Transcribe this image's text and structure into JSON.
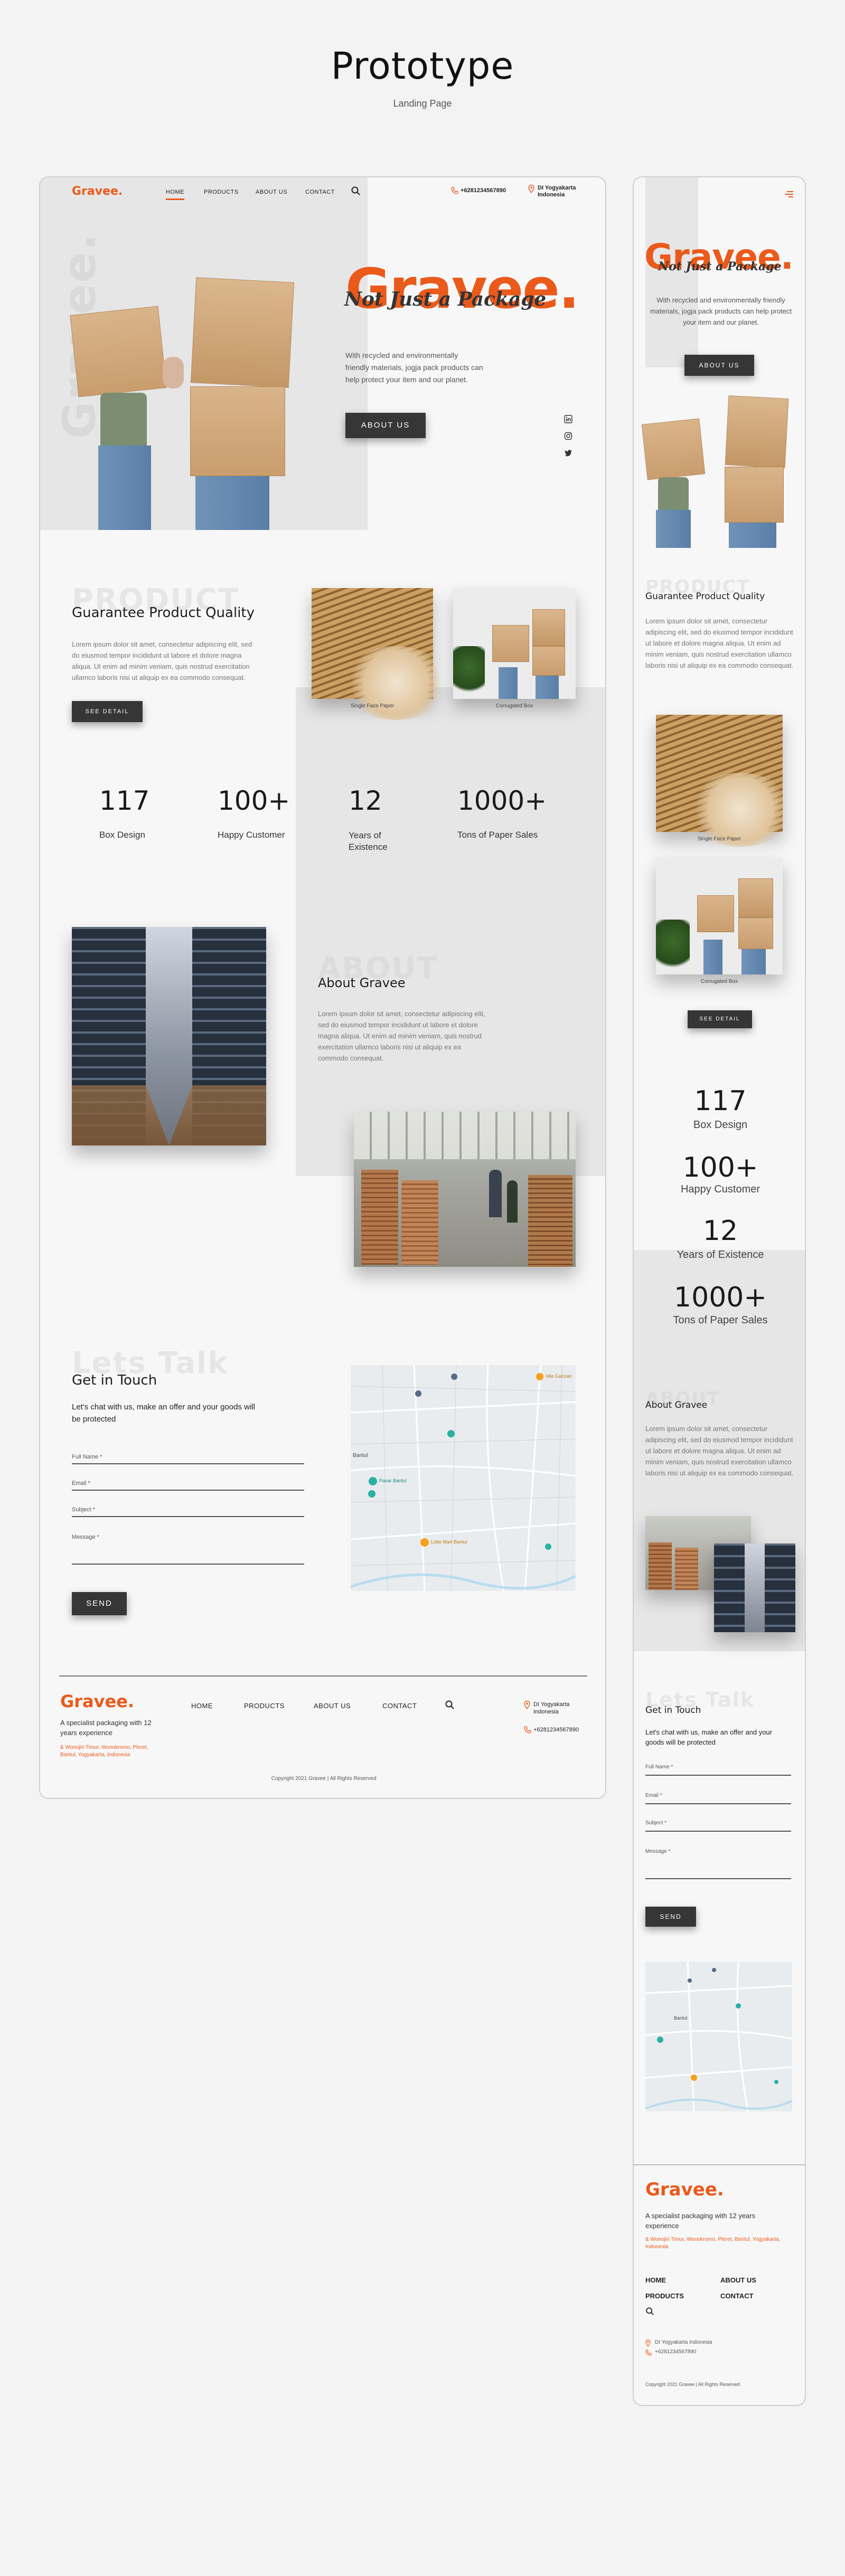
{
  "page": {
    "title": "Prototype",
    "subtitle": "Landing Page"
  },
  "brand": {
    "logo": "Gravee.",
    "tagline": "Not Just a Package",
    "accent": "#ea5a1b"
  },
  "nav": {
    "items": [
      "HOME",
      "PRODUCTS",
      "ABOUT US",
      "CONTACT"
    ],
    "phone": "+6281234567890",
    "address_line1": "DI Yogyakarta",
    "address_line2": "Indonesia"
  },
  "hero": {
    "ghost": "Gravee.",
    "title": "Gravee.",
    "script": "Not Just a Package",
    "text": "With recycled and environmentally friendly materials, jogja pack products can help protect your item and our planet.",
    "cta": "ABOUT US",
    "social_icons": [
      "linkedin-icon",
      "instagram-icon",
      "twitter-icon"
    ]
  },
  "product": {
    "ghost": "PRODUCT",
    "title": "Guarantee Product Quality",
    "text": "Lorem ipsum dolor sit amet, consectetur adipiscing elit, sed do eiusmod tempor incididunt ut labore et dolore magna aliqua. Ut enim ad minim veniam, quis nostrud exercitation ullamco laboris nisi ut aliquip ex ea commodo consequat.",
    "cta": "SEE DETAIL",
    "items": [
      {
        "caption": "Single Face Paper"
      },
      {
        "caption": "Corrugated Box"
      }
    ]
  },
  "stats": [
    {
      "value": "117",
      "label": "Box Design"
    },
    {
      "value": "100+",
      "label": "Happy Customer"
    },
    {
      "value": "12",
      "label": "Years of Existence"
    },
    {
      "value": "1000+",
      "label": "Tons of Paper Sales"
    }
  ],
  "about": {
    "ghost": "ABOUT",
    "title": "About Gravee",
    "text": "Lorem ipsum dolor sit amet, consectetur adipiscing elit, sed do eiusmod tempor incididunt ut labore et dolore magna aliqua. Ut enim ad minim veniam, quis nostrud exercitation ullamco laboris nisi ut aliquip ex ea commodo consequat."
  },
  "contact": {
    "ghost": "Lets Talk",
    "title": "Get in Touch",
    "text": "Let's chat with us, make an offer and your goods will be protected",
    "fields": [
      "Full Name *",
      "Email *",
      "Subject *",
      "Message *"
    ],
    "send": "SEND",
    "map_labels": [
      "Bantul",
      "Mie Gacoan",
      "Lotte Mart Bantul",
      "Pasar Bantul"
    ]
  },
  "footer": {
    "logo": "Gravee.",
    "tagline": "A specialist packaging with 12 years experience",
    "links_colored": "& Wonojiri Timur, Wonokromo, Pleret, Bantul, Yogyakarta, Indonesia",
    "links_colored_mobile": "& Wonojiri Timur, Wonokromo, Pleret, Bantul, Yogyakarta, Indonesia",
    "nav": [
      "HOME",
      "PRODUCTS",
      "ABOUT US",
      "CONTACT"
    ],
    "address": "DI Yogyakarta Indonesia",
    "phone": "+6281234567890",
    "copyright": "Copyright 2021 Gravee | All Rights Reserved"
  }
}
